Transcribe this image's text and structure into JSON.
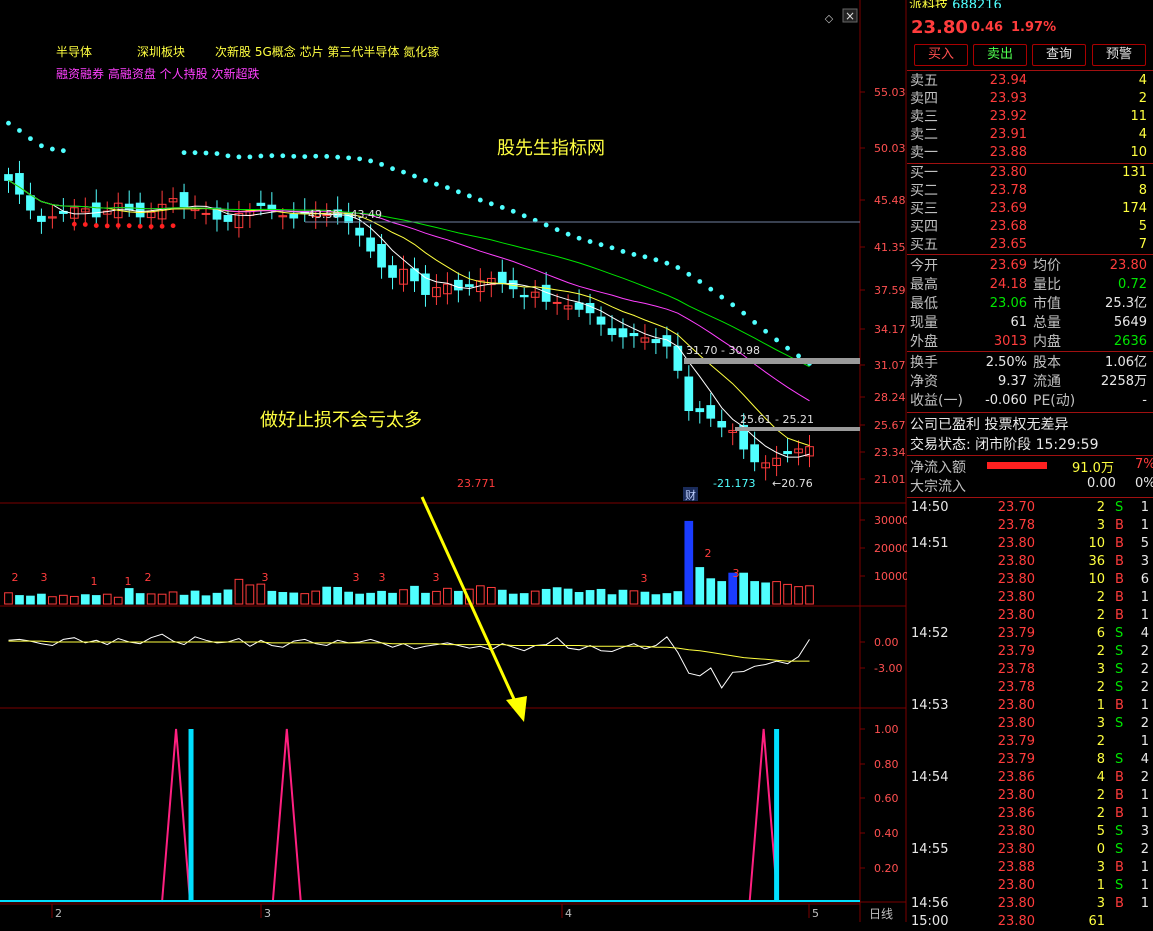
{
  "sector_tags_line1": [
    "半导体",
    "深圳板块",
    "次新股 5G概念 芯片 第三代半导体 氮化镓"
  ],
  "sector_tags_line2": "融资融券 高融资盘 个人持股 次新超跌",
  "watermark": "股先生指标网",
  "annotation": "做好止损不会亏太多",
  "chart_data": [
    {
      "type": "candlestick",
      "title": "",
      "y_ticks": [
        "55.03",
        "50.03",
        "45.48",
        "41.35",
        "37.59",
        "34.17",
        "31.07",
        "28.24",
        "25.67",
        "23.34",
        "21.01"
      ],
      "ylim": [
        21.01,
        55.03
      ],
      "price_labels": [
        {
          "text": "43.50 - 43.49"
        },
        {
          "text": "31.70 - 30.98"
        },
        {
          "text": "25.61 - 25.21"
        },
        {
          "text": "-21.173"
        },
        {
          "text": "20.76"
        },
        {
          "text": "23.771"
        }
      ],
      "fin_badge": "财",
      "closes": [
        47.2,
        46.0,
        44.6,
        43.6,
        44.0,
        44.3,
        44.8,
        44.7,
        44.0,
        44.5,
        45.2,
        44.6,
        44.0,
        44.4,
        45.1,
        45.6,
        44.9,
        44.7,
        44.3,
        43.8,
        43.6,
        44.3,
        44.6,
        45.0,
        44.6,
        44.1,
        43.9,
        44.3,
        44.6,
        44.2,
        44.0,
        43.5,
        42.4,
        41.0,
        39.6,
        38.7,
        39.4,
        38.4,
        37.2,
        37.8,
        38.1,
        37.6,
        37.9,
        38.4,
        38.6,
        38.2,
        37.7,
        37.0,
        37.4,
        36.6,
        36.5,
        36.2,
        35.9,
        35.6,
        34.6,
        33.7,
        33.5,
        33.6,
        33.4,
        33.0,
        32.7,
        30.6,
        27.0,
        26.9,
        26.3,
        25.5,
        25.2,
        23.6,
        22.5,
        22.4,
        22.8,
        23.2,
        23.6,
        23.8
      ],
      "overlay_line": {
        "level_label": "43.50 - 43.49"
      },
      "sar_dots": "above/below price, cyan when above, red when below"
    },
    {
      "type": "bar",
      "title": "",
      "y_ticks": [
        "30000",
        "20000",
        "10000"
      ],
      "ylim": [
        0,
        33000
      ],
      "values": [
        4000,
        3000,
        2800,
        3500,
        2600,
        3100,
        2700,
        3300,
        3000,
        3500,
        2400,
        5500,
        3700,
        3600,
        3500,
        4300,
        3100,
        4600,
        2900,
        3800,
        5000,
        8800,
        6800,
        7100,
        4500,
        4100,
        3900,
        3700,
        4600,
        6000,
        5900,
        4200,
        3500,
        3800,
        4500,
        3800,
        5100,
        6300,
        3800,
        4500,
        5600,
        4500,
        5300,
        6500,
        5900,
        4900,
        3500,
        3700,
        4600,
        5200,
        5800,
        5300,
        4100,
        4800,
        5200,
        3300,
        4900,
        4700,
        4200,
        3300,
        3700,
        4400,
        29500,
        13000,
        9000,
        8000,
        11000,
        11000,
        8000,
        7500,
        8000,
        7000,
        6200,
        6500
      ],
      "markers": [
        {
          "text": "2"
        },
        {
          "text": "3"
        },
        {
          "text": "1"
        },
        {
          "text": "1"
        },
        {
          "text": "2"
        },
        {
          "text": "3"
        },
        {
          "text": "3"
        },
        {
          "text": "3"
        },
        {
          "text": "3"
        },
        {
          "text": "3"
        },
        {
          "text": "2"
        },
        {
          "text": "3"
        }
      ]
    },
    {
      "type": "line",
      "title": "",
      "y_ticks": [
        "0.00",
        "-3.00"
      ],
      "ylim": [
        -5.5,
        2.0
      ],
      "series": [
        {
          "color": "#ffffff",
          "values": [
            0.2,
            0.3,
            0.1,
            -0.2,
            -0.4,
            0.3,
            0.5,
            -0.1,
            0.2,
            -0.3,
            0.4,
            0.0,
            -0.2,
            0.5,
            0.9,
            0.1,
            -0.3,
            0.6,
            0.2,
            -0.1,
            0.0,
            0.4,
            -0.5,
            0.2,
            -0.4,
            -0.6,
            0.1,
            0.3,
            -0.2,
            -0.4,
            0.2,
            -0.1,
            0.0,
            0.3,
            -0.1,
            -0.6,
            -0.2,
            -0.8,
            -0.5,
            -0.3,
            -0.1,
            -0.4,
            -0.7,
            -0.5,
            -0.9,
            -0.2,
            -0.6,
            -1.0,
            -0.4,
            -0.3,
            0.5,
            -0.7,
            -0.9,
            -0.4,
            -1.0,
            -1.1,
            -0.6,
            -0.2,
            -0.8,
            -0.4,
            0.6,
            -1.2,
            -3.6,
            -3.9,
            -3.0,
            -5.3,
            -3.5,
            -3.4,
            -2.8,
            -2.6,
            -2.2,
            -2.5,
            -1.7,
            0.3
          ]
        },
        {
          "color": "#ffff40",
          "values": [
            0.1,
            0.1,
            0.1,
            0.1,
            0.0,
            0.0,
            0.0,
            0.0,
            0.0,
            0.0,
            0.0,
            0.0,
            0.0,
            0.0,
            0.0,
            0.0,
            0.0,
            0.0,
            0.0,
            0.0,
            0.0,
            0.0,
            0.0,
            0.0,
            -0.1,
            -0.1,
            -0.1,
            -0.1,
            -0.1,
            -0.1,
            -0.1,
            -0.1,
            -0.1,
            -0.1,
            -0.1,
            -0.2,
            -0.2,
            -0.2,
            -0.2,
            -0.2,
            -0.3,
            -0.3,
            -0.3,
            -0.3,
            -0.3,
            -0.3,
            -0.4,
            -0.4,
            -0.4,
            -0.4,
            -0.4,
            -0.4,
            -0.4,
            -0.5,
            -0.5,
            -0.5,
            -0.5,
            -0.5,
            -0.5,
            -0.6,
            -0.6,
            -0.7,
            -0.9,
            -1.0,
            -1.2,
            -1.4,
            -1.6,
            -1.8,
            -1.9,
            -2.0,
            -2.1,
            -2.2,
            -2.2,
            -2.2
          ]
        }
      ]
    },
    {
      "type": "bar",
      "title": "",
      "y_ticks": [
        "1.00",
        "0.80",
        "0.60",
        "0.40",
        "0.20"
      ],
      "ylim": [
        0,
        1.0
      ],
      "signals": [
        {
          "index": 17,
          "value": 1.0
        },
        {
          "index": 70,
          "value": 1.0
        }
      ],
      "spikes": [
        {
          "index": 16
        },
        {
          "index": 25
        },
        {
          "index": 69
        }
      ]
    }
  ],
  "x_axis_labels": [
    "2",
    "3",
    "4",
    "5"
  ],
  "period_label": "日线",
  "quote": {
    "title": "派科技",
    "code": "688216",
    "price": "23.80",
    "change": "0.46",
    "change_pct": "1.97%",
    "buttons": [
      "买入",
      "卖出",
      "查询",
      "预警"
    ],
    "asks": [
      {
        "label": "卖五",
        "price": "23.94",
        "vol": "4"
      },
      {
        "label": "卖四",
        "price": "23.93",
        "vol": "2"
      },
      {
        "label": "卖三",
        "price": "23.92",
        "vol": "11"
      },
      {
        "label": "卖二",
        "price": "23.91",
        "vol": "4"
      },
      {
        "label": "卖一",
        "price": "23.88",
        "vol": "10"
      }
    ],
    "bids": [
      {
        "label": "买一",
        "price": "23.80",
        "vol": "131"
      },
      {
        "label": "买二",
        "price": "23.78",
        "vol": "8"
      },
      {
        "label": "买三",
        "price": "23.69",
        "vol": "174"
      },
      {
        "label": "买四",
        "price": "23.68",
        "vol": "5"
      },
      {
        "label": "买五",
        "price": "23.65",
        "vol": "7"
      }
    ],
    "stats": [
      {
        "l1": "今开",
        "v1": "23.69",
        "c1": "red",
        "l2": "均价",
        "v2": "23.80",
        "c2": "red"
      },
      {
        "l1": "最高",
        "v1": "24.18",
        "c1": "red",
        "l2": "量比",
        "v2": "0.72",
        "c2": "green"
      },
      {
        "l1": "最低",
        "v1": "23.06",
        "c1": "green",
        "l2": "市值",
        "v2": "25.3亿",
        "c2": "white"
      },
      {
        "l1": "现量",
        "v1": "61",
        "c1": "white",
        "l2": "总量",
        "v2": "5649",
        "c2": "white"
      },
      {
        "l1": "外盘",
        "v1": "3013",
        "c1": "red",
        "l2": "内盘",
        "v2": "2636",
        "c2": "green"
      }
    ],
    "stats2": [
      {
        "l1": "换手",
        "v1": "2.50%",
        "l2": "股本",
        "v2": "1.06亿"
      },
      {
        "l1": "净资",
        "v1": "9.37",
        "l2": "流通",
        "v2": "2258万"
      },
      {
        "l1": "收益(一)",
        "v1": "-0.060",
        "l2": "PE(动)",
        "v2": "-"
      }
    ],
    "note": "公司已盈利 投票权无差异",
    "trade_status": "交易状态: 闭市阶段 15:29:59",
    "net_inflow_label": "净流入额",
    "net_inflow": "91.0万",
    "net_inflow_pct": "7%",
    "block_flow_label": "大宗流入",
    "block_flow": "0.00",
    "block_flow_pct": "0%"
  },
  "ticks": [
    {
      "time": "14:50",
      "price": "23.70",
      "vol": "2",
      "dir": "S",
      "n": "1"
    },
    {
      "time": "",
      "price": "23.78",
      "vol": "3",
      "dir": "B",
      "n": "1"
    },
    {
      "time": "14:51",
      "price": "23.80",
      "vol": "10",
      "dir": "B",
      "n": "5"
    },
    {
      "time": "",
      "price": "23.80",
      "vol": "36",
      "dir": "B",
      "n": "3"
    },
    {
      "time": "",
      "price": "23.80",
      "vol": "10",
      "dir": "B",
      "n": "6"
    },
    {
      "time": "",
      "price": "23.80",
      "vol": "2",
      "dir": "B",
      "n": "1"
    },
    {
      "time": "",
      "price": "23.80",
      "vol": "2",
      "dir": "B",
      "n": "1"
    },
    {
      "time": "14:52",
      "price": "23.79",
      "vol": "6",
      "dir": "S",
      "n": "4"
    },
    {
      "time": "",
      "price": "23.79",
      "vol": "2",
      "dir": "S",
      "n": "2"
    },
    {
      "time": "",
      "price": "23.78",
      "vol": "3",
      "dir": "S",
      "n": "2"
    },
    {
      "time": "",
      "price": "23.78",
      "vol": "2",
      "dir": "S",
      "n": "2"
    },
    {
      "time": "14:53",
      "price": "23.80",
      "vol": "1",
      "dir": "B",
      "n": "1"
    },
    {
      "time": "",
      "price": "23.80",
      "vol": "3",
      "dir": "S",
      "n": "2"
    },
    {
      "time": "",
      "price": "23.79",
      "vol": "2",
      "dir": "",
      "n": "1"
    },
    {
      "time": "",
      "price": "23.79",
      "vol": "8",
      "dir": "S",
      "n": "4"
    },
    {
      "time": "14:54",
      "price": "23.86",
      "vol": "4",
      "dir": "B",
      "n": "2"
    },
    {
      "time": "",
      "price": "23.80",
      "vol": "2",
      "dir": "B",
      "n": "1"
    },
    {
      "time": "",
      "price": "23.86",
      "vol": "2",
      "dir": "B",
      "n": "1"
    },
    {
      "time": "",
      "price": "23.80",
      "vol": "5",
      "dir": "S",
      "n": "3"
    },
    {
      "time": "14:55",
      "price": "23.80",
      "vol": "0",
      "dir": "S",
      "n": "2"
    },
    {
      "time": "",
      "price": "23.88",
      "vol": "3",
      "dir": "B",
      "n": "1"
    },
    {
      "time": "",
      "price": "23.80",
      "vol": "1",
      "dir": "S",
      "n": "1"
    },
    {
      "time": "14:56",
      "price": "23.80",
      "vol": "3",
      "dir": "B",
      "n": "1"
    },
    {
      "time": "15:00",
      "price": "23.80",
      "vol": "61",
      "dir": "",
      "n": ""
    }
  ],
  "colors": {
    "up": "#ff3c3c",
    "down": "#50ffff",
    "grid": "#7a0000",
    "sar_up": "#50ffff",
    "sar_down": "#ff2020",
    "arrow": "#ffff00",
    "signal": "#ff2080"
  }
}
